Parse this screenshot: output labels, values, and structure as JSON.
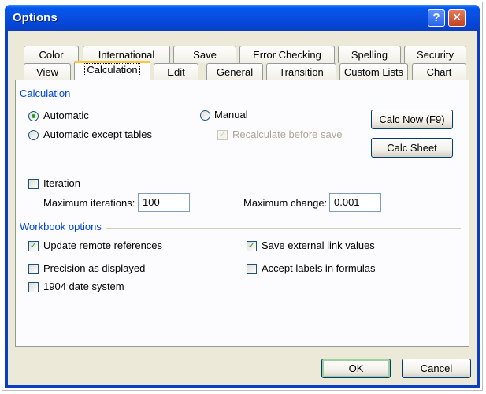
{
  "window": {
    "title": "Options"
  },
  "titlebar": {
    "help_glyph": "?",
    "close_glyph": "✕"
  },
  "tabs_row1": [
    "Color",
    "International",
    "Save",
    "Error Checking",
    "Spelling",
    "Security"
  ],
  "tabs_row2": [
    "View",
    "Calculation",
    "Edit",
    "General",
    "Transition",
    "Custom Lists",
    "Chart"
  ],
  "active_tab": "Calculation",
  "calculation": {
    "group_label": "Calculation",
    "automatic_label": "Automatic",
    "automatic_except_tables_label": "Automatic except tables",
    "manual_label": "Manual",
    "recalculate_before_save_label": "Recalculate before save",
    "calc_now_label": "Calc Now (F9)",
    "calc_sheet_label": "Calc Sheet",
    "selected": "Automatic",
    "recalculate_before_save_checked": true
  },
  "iteration": {
    "label": "Iteration",
    "checked": false,
    "max_iterations_label": "Maximum iterations:",
    "max_iterations_value": "100",
    "max_change_label": "Maximum change:",
    "max_change_value": "0.001"
  },
  "workbook": {
    "group_label": "Workbook options",
    "update_remote_label": "Update remote references",
    "update_remote_checked": true,
    "precision_label": "Precision as displayed",
    "precision_checked": false,
    "date1904_label": "1904 date system",
    "date1904_checked": false,
    "save_external_label": "Save external link values",
    "save_external_checked": true,
    "accept_labels_label": "Accept labels in formulas",
    "accept_labels_checked": false
  },
  "footer": {
    "ok_label": "OK",
    "cancel_label": "Cancel"
  },
  "colors": {
    "title_bar": "#0a4ee0",
    "dialog_bg": "#ece9d8",
    "panel_bg": "#fcfcfe",
    "group_label": "#0046d5",
    "check_mark": "#21a121"
  }
}
